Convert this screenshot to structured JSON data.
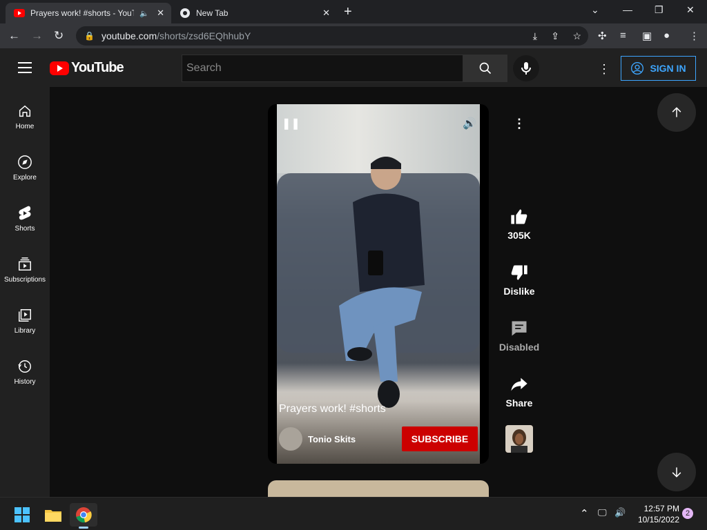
{
  "browser": {
    "tabs": [
      {
        "title": "Prayers work! #shorts - YouTube",
        "icon": "youtube-favicon"
      },
      {
        "title": "New Tab",
        "icon": "chrome-favicon"
      }
    ],
    "url_host": "youtube.com",
    "url_path": "/shorts/zsd6EQhhubY"
  },
  "youtube": {
    "logo_text": "YouTube",
    "search": {
      "placeholder": "Search"
    },
    "signin_label": "SIGN IN",
    "sidebar": [
      {
        "label": "Home",
        "icon": "home-icon"
      },
      {
        "label": "Explore",
        "icon": "compass-icon"
      },
      {
        "label": "Shorts",
        "icon": "shorts-icon"
      },
      {
        "label": "Subscriptions",
        "icon": "subscriptions-icon"
      },
      {
        "label": "Library",
        "icon": "library-icon"
      },
      {
        "label": "History",
        "icon": "history-icon"
      }
    ],
    "short": {
      "title": "Prayers work! #shorts",
      "channel": "Tonio Skits",
      "subscribe_label": "SUBSCRIBE",
      "likes": "305K",
      "dislike_label": "Dislike",
      "comments_label": "Disabled",
      "share_label": "Share"
    }
  },
  "taskbar": {
    "time": "12:57 PM",
    "date": "10/15/2022",
    "notifications": "2"
  },
  "colors": {
    "accent_blue": "#3ea6ff",
    "subscribe_red": "#cc0000",
    "yt_red": "#ff0000"
  }
}
